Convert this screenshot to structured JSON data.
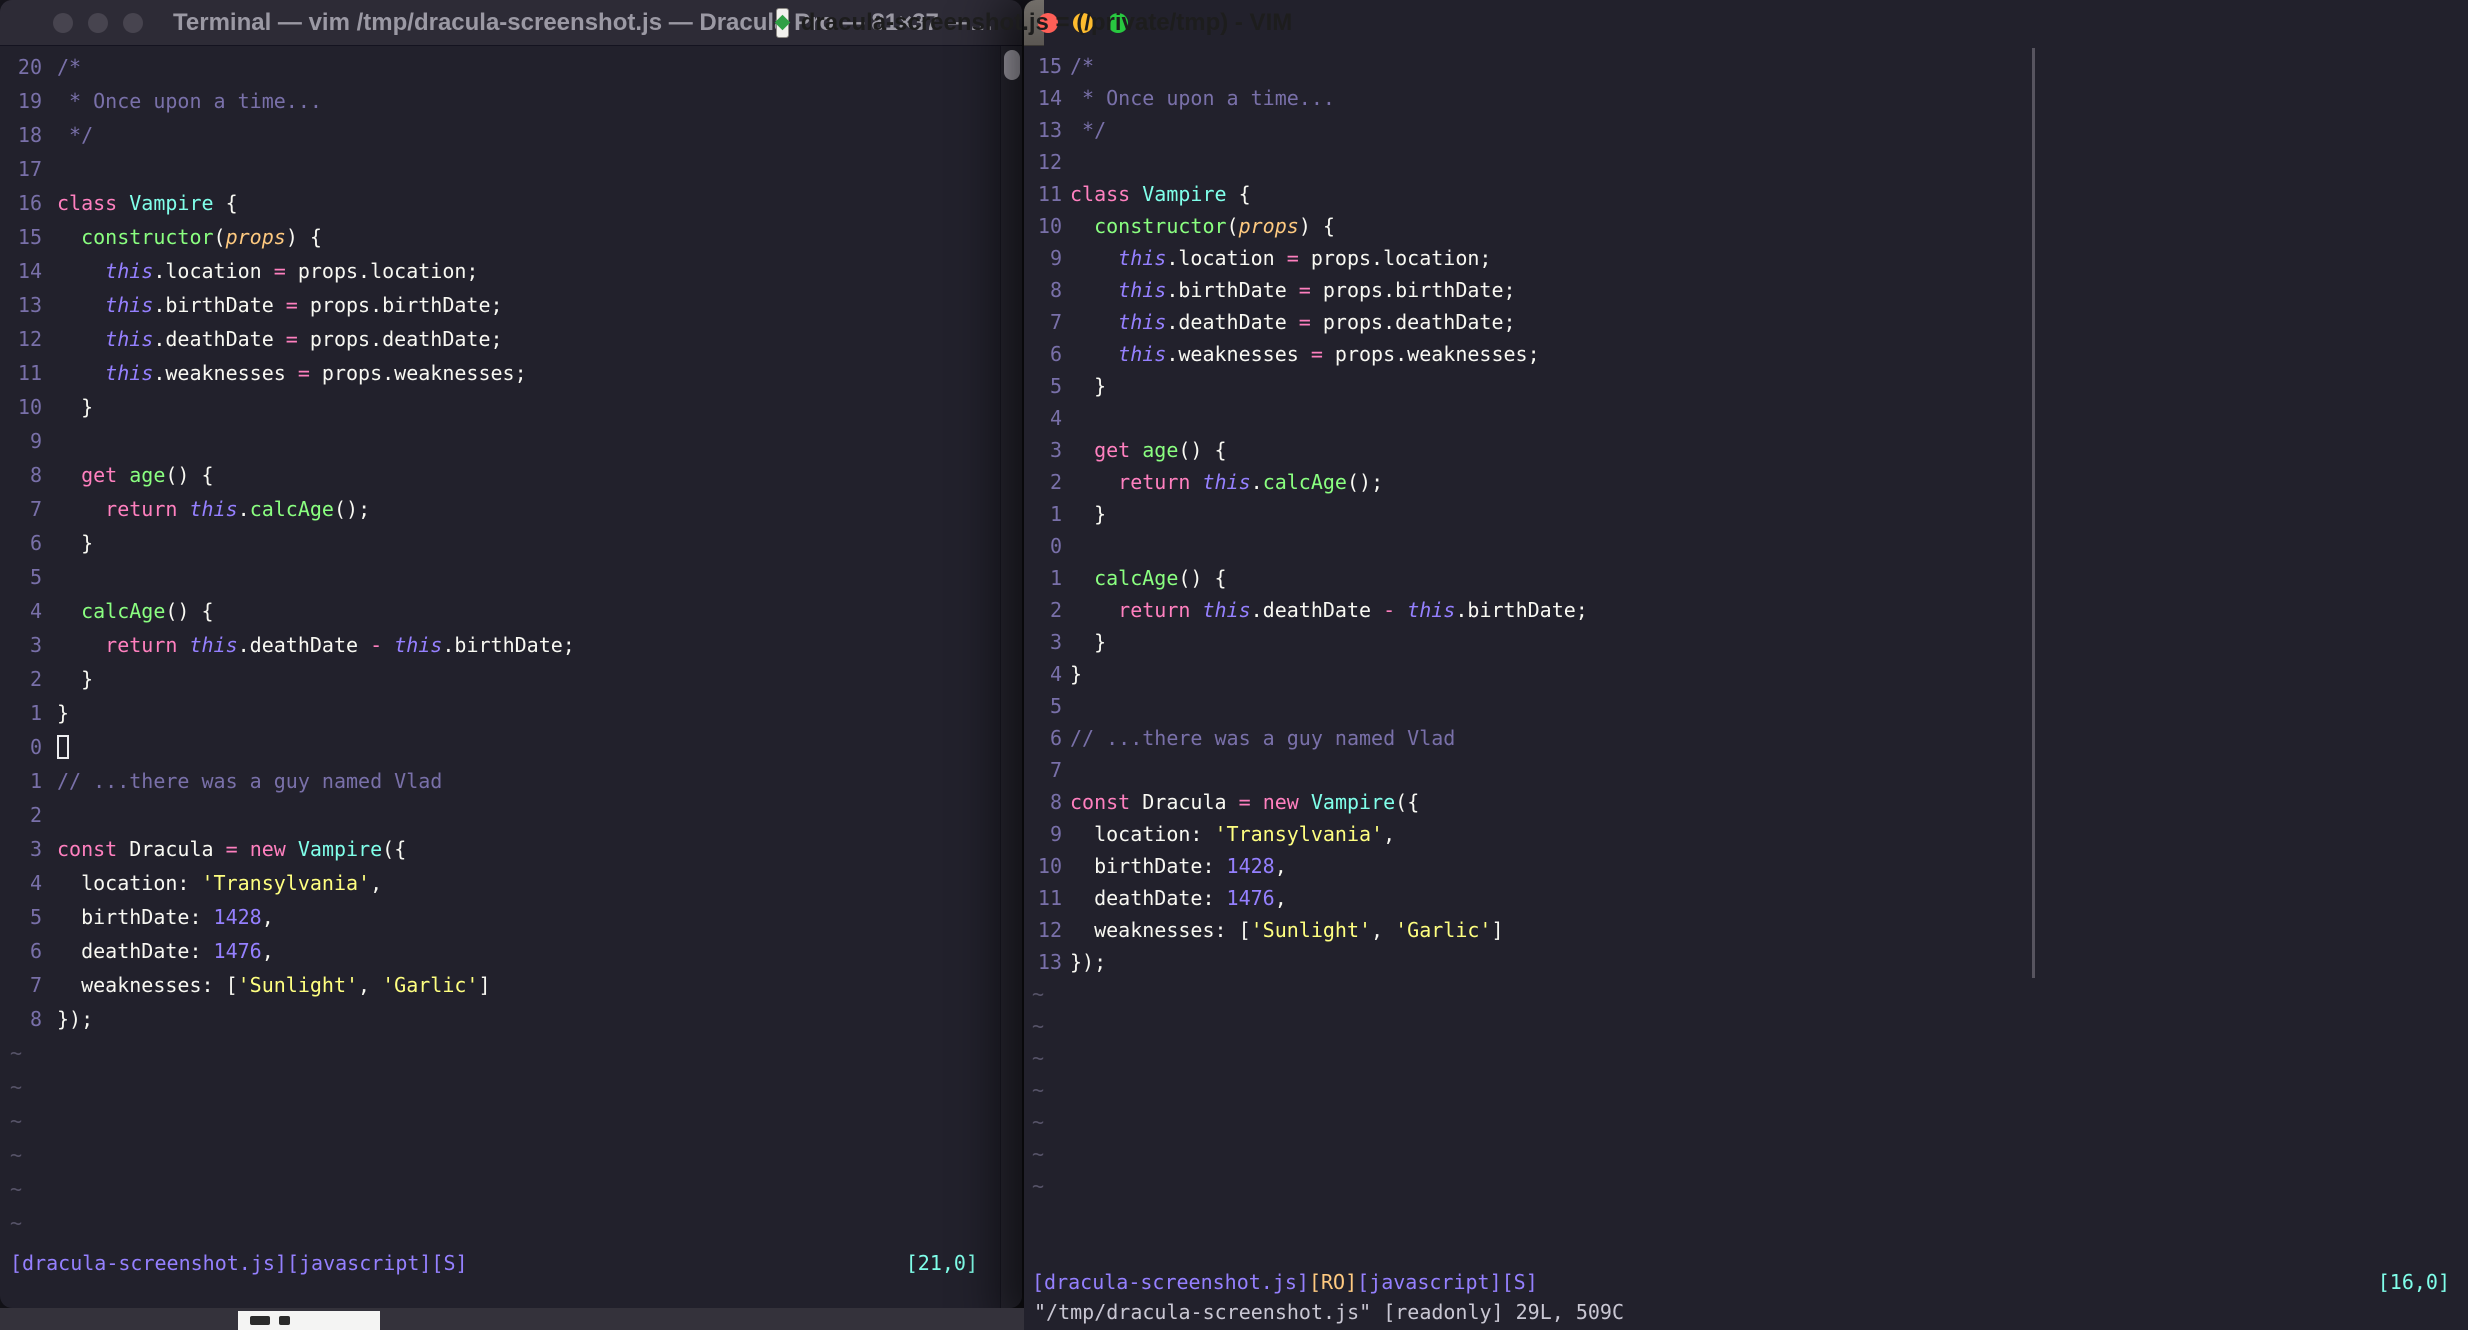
{
  "palette": {
    "background": "#22212C",
    "foreground": "#F8F8F2",
    "comment": "#7970A9",
    "cyan": "#80FFEA",
    "green": "#8AFF80",
    "orange": "#FFCA80",
    "pink": "#FF80BF",
    "purple": "#9580FF",
    "yellow": "#FFFF80",
    "line_number": "#7970A9",
    "titlebar_inactive": "#2D2B36",
    "titlebar_active": "#6C6863",
    "traffic_red": "#FF5F57",
    "traffic_yellow": "#FEBC2E",
    "traffic_green": "#28C840"
  },
  "buffer": {
    "lines": [
      {
        "segments": [
          [
            "cm",
            "/*"
          ]
        ]
      },
      {
        "segments": [
          [
            "cm",
            " * Once upon a time..."
          ]
        ]
      },
      {
        "segments": [
          [
            "cm",
            " */"
          ]
        ]
      },
      {
        "segments": []
      },
      {
        "segments": [
          [
            "pk",
            "class"
          ],
          [
            "fg",
            " "
          ],
          [
            "cy",
            "Vampire"
          ],
          [
            "fg",
            " {"
          ]
        ]
      },
      {
        "segments": [
          [
            "fg",
            "  "
          ],
          [
            "gr",
            "constructor"
          ],
          [
            "fg",
            "("
          ],
          [
            "or",
            "props"
          ],
          [
            "fg",
            ") {"
          ]
        ]
      },
      {
        "segments": [
          [
            "fg",
            "    "
          ],
          [
            "pi",
            "this"
          ],
          [
            "fg",
            ".location "
          ],
          [
            "pk",
            "="
          ],
          [
            "fg",
            " props.location;"
          ]
        ]
      },
      {
        "segments": [
          [
            "fg",
            "    "
          ],
          [
            "pi",
            "this"
          ],
          [
            "fg",
            ".birthDate "
          ],
          [
            "pk",
            "="
          ],
          [
            "fg",
            " props.birthDate;"
          ]
        ]
      },
      {
        "segments": [
          [
            "fg",
            "    "
          ],
          [
            "pi",
            "this"
          ],
          [
            "fg",
            ".deathDate "
          ],
          [
            "pk",
            "="
          ],
          [
            "fg",
            " props.deathDate;"
          ]
        ]
      },
      {
        "segments": [
          [
            "fg",
            "    "
          ],
          [
            "pi",
            "this"
          ],
          [
            "fg",
            ".weaknesses "
          ],
          [
            "pk",
            "="
          ],
          [
            "fg",
            " props.weaknesses;"
          ]
        ]
      },
      {
        "segments": [
          [
            "fg",
            "  }"
          ]
        ]
      },
      {
        "segments": []
      },
      {
        "segments": [
          [
            "fg",
            "  "
          ],
          [
            "pk",
            "get"
          ],
          [
            "fg",
            " "
          ],
          [
            "gr",
            "age"
          ],
          [
            "fg",
            "() {"
          ]
        ]
      },
      {
        "segments": [
          [
            "fg",
            "    "
          ],
          [
            "pk",
            "return"
          ],
          [
            "fg",
            " "
          ],
          [
            "pi",
            "this"
          ],
          [
            "fg",
            "."
          ],
          [
            "gr",
            "calcAge"
          ],
          [
            "fg",
            "();"
          ]
        ]
      },
      {
        "segments": [
          [
            "fg",
            "  }"
          ]
        ]
      },
      {
        "segments": []
      },
      {
        "segments": [
          [
            "fg",
            "  "
          ],
          [
            "gr",
            "calcAge"
          ],
          [
            "fg",
            "() {"
          ]
        ]
      },
      {
        "segments": [
          [
            "fg",
            "    "
          ],
          [
            "pk",
            "return"
          ],
          [
            "fg",
            " "
          ],
          [
            "pi",
            "this"
          ],
          [
            "fg",
            ".deathDate "
          ],
          [
            "pk",
            "-"
          ],
          [
            "fg",
            " "
          ],
          [
            "pi",
            "this"
          ],
          [
            "fg",
            ".birthDate;"
          ]
        ]
      },
      {
        "segments": [
          [
            "fg",
            "  }"
          ]
        ]
      },
      {
        "segments": [
          [
            "fg",
            "}"
          ]
        ]
      },
      {
        "segments": []
      },
      {
        "segments": [
          [
            "cm",
            "// ...there was a guy named Vlad"
          ]
        ]
      },
      {
        "segments": []
      },
      {
        "segments": [
          [
            "pk",
            "const"
          ],
          [
            "fg",
            " Dracula "
          ],
          [
            "pk",
            "="
          ],
          [
            "fg",
            " "
          ],
          [
            "pk",
            "new"
          ],
          [
            "fg",
            " "
          ],
          [
            "cy",
            "Vampire"
          ],
          [
            "fg",
            "({"
          ]
        ]
      },
      {
        "segments": [
          [
            "fg",
            "  location: "
          ],
          [
            "ye",
            "'Transylvania'"
          ],
          [
            "fg",
            ","
          ]
        ]
      },
      {
        "segments": [
          [
            "fg",
            "  birthDate: "
          ],
          [
            "pu",
            "1428"
          ],
          [
            "fg",
            ","
          ]
        ]
      },
      {
        "segments": [
          [
            "fg",
            "  deathDate: "
          ],
          [
            "pu",
            "1476"
          ],
          [
            "fg",
            ","
          ]
        ]
      },
      {
        "segments": [
          [
            "fg",
            "  weaknesses: ["
          ],
          [
            "ye",
            "'Sunlight'"
          ],
          [
            "fg",
            ", "
          ],
          [
            "ye",
            "'Garlic'"
          ],
          [
            "fg",
            "]"
          ]
        ]
      },
      {
        "segments": [
          [
            "fg",
            "});"
          ]
        ]
      }
    ]
  },
  "left_window": {
    "title": "Terminal — vim /tmp/dracula-screenshot.js — Dracula Pro — 81×37 —…",
    "line_numbers": [
      "20",
      "19",
      "18",
      "17",
      "16",
      "15",
      "14",
      "13",
      "12",
      "11",
      "10",
      "9",
      "8",
      "7",
      "6",
      "5",
      "4",
      "3",
      "2",
      "1",
      "0",
      "1",
      "2",
      "3",
      "4",
      "5",
      "6",
      "7",
      "8"
    ],
    "tilde_count": 6,
    "cursor": {
      "line": 21,
      "col": 0,
      "style": "hollow"
    },
    "statusline_left": "[dracula-screenshot.js][javascript][S]",
    "statusline_right": "[21,0]"
  },
  "right_window": {
    "title": "dracula-screenshot.js = (/private/tmp) - VIM",
    "line_numbers": [
      "15",
      "14",
      "13",
      "12",
      "11",
      "10",
      "9",
      "8",
      "7",
      "6",
      "5",
      "4",
      "3",
      "2",
      "1",
      "0",
      "1",
      "2",
      "3",
      "4",
      "5",
      "6",
      "7",
      "8",
      "9",
      "10",
      "11",
      "12",
      "13"
    ],
    "tilde_count": 7,
    "statusline_segments": [
      [
        "pu",
        "[dracula-screenshot.js]"
      ],
      [
        "or",
        "[RO]"
      ],
      [
        "pu",
        "[javascript][S]"
      ]
    ],
    "statusline_right": "[16,0]",
    "message_line": "\"/tmp/dracula-screenshot.js\" [readonly] 29L, 509C"
  }
}
